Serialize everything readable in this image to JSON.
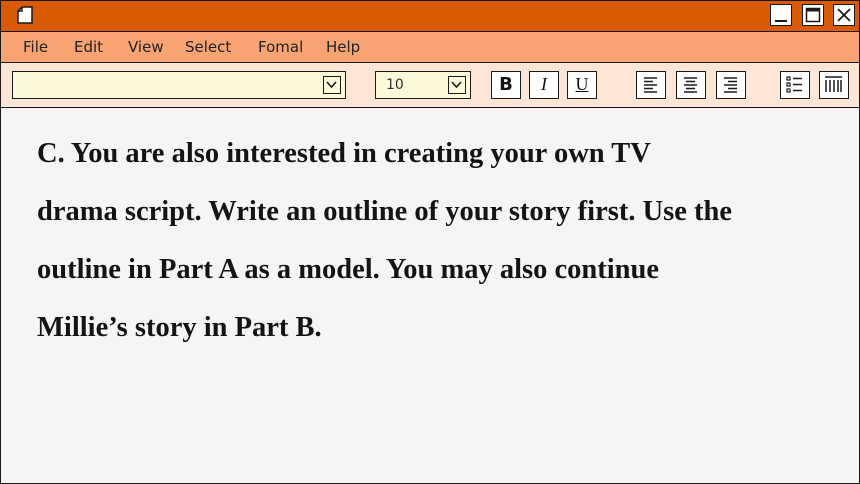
{
  "window": {
    "titlebar_color": "#d95a00",
    "menubar_color": "#f7a472",
    "toolbar_color": "#fde6d6",
    "controls": [
      "minimize-icon",
      "maximize-icon",
      "close-icon"
    ]
  },
  "menu": {
    "file": "File",
    "edit": "Edit",
    "view": "View",
    "select": "Select",
    "format": "Fomal",
    "help": "Help"
  },
  "toolbar": {
    "font_value": "",
    "font_size": "10",
    "bold_label": "B",
    "italic_label": "I",
    "underline_label": "U",
    "icons": [
      "align-left-icon",
      "align-center-icon",
      "align-right-icon",
      "bullet-list-icon",
      "columns-icon"
    ]
  },
  "document": {
    "lines": [
      "C. You are also interested in creating your own TV",
      "drama script. Write an outline of your story first. Use the",
      "outline in Part A as a model. You may also continue",
      "Millie’s story in Part B."
    ]
  }
}
